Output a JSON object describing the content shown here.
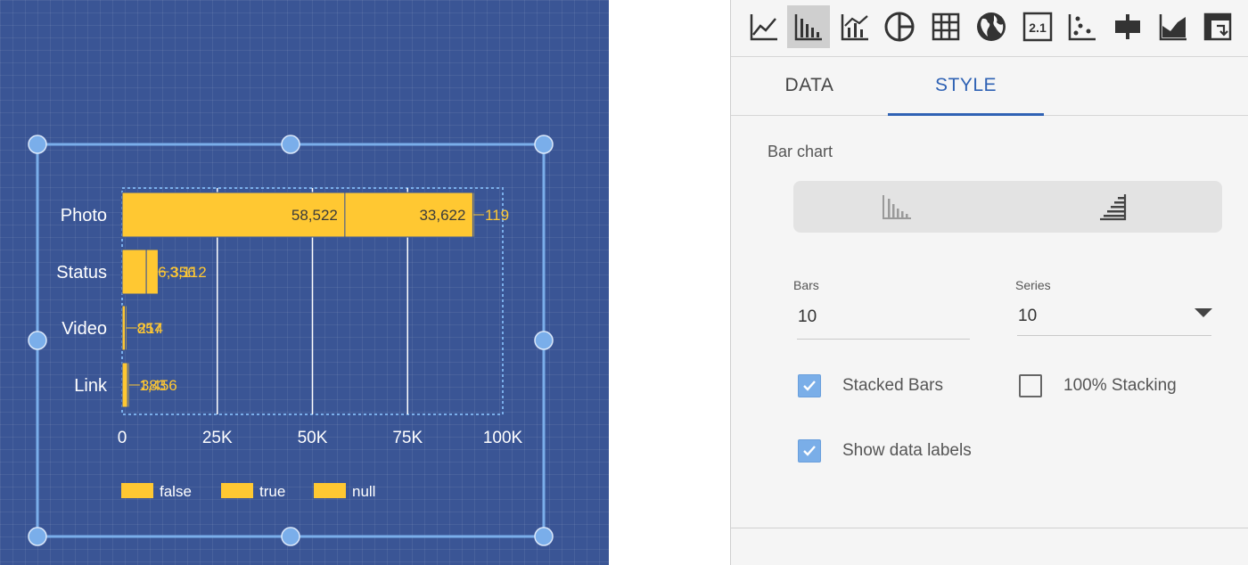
{
  "chart_data": {
    "type": "bar",
    "orientation": "horizontal",
    "stacked": true,
    "categories": [
      "Photo",
      "Status",
      "Video",
      "Link"
    ],
    "series": [
      {
        "name": "false",
        "values": [
          58522,
          6356,
          857,
          1456
        ]
      },
      {
        "name": "true",
        "values": [
          33622,
          3112,
          214,
          383
        ]
      },
      {
        "name": "null",
        "values": [
          119,
          0,
          0,
          0
        ]
      }
    ],
    "data_labels": [
      [
        "58,522",
        "33,622",
        "119"
      ],
      [
        "6,356",
        "3,112",
        ""
      ],
      [
        "857",
        "214",
        ""
      ],
      [
        "1,456",
        "383",
        ""
      ]
    ],
    "xticks": [
      "0",
      "25K",
      "50K",
      "75K",
      "100K"
    ],
    "xlim": [
      0,
      100000
    ],
    "grid": true,
    "legend_position": "bottom-left",
    "colors": {
      "bar": "#ffc832",
      "label_inside": "#3b3b3b",
      "label_outside": "#ffc832",
      "background": "#3a5595",
      "selection": "#7aaeea"
    }
  },
  "toolbar": {
    "icons": [
      "line-chart-icon",
      "bar-chart-icon",
      "combo-chart-icon",
      "pie-chart-icon",
      "table-icon",
      "geo-map-icon",
      "scorecard-icon",
      "scatter-chart-icon",
      "bullet-chart-icon",
      "area-chart-icon",
      "pivot-table-icon"
    ],
    "selected": "bar-chart-icon",
    "scorecard_glyph": "2.1"
  },
  "tabs": [
    {
      "label": "DATA",
      "active": false
    },
    {
      "label": "STYLE",
      "active": true
    }
  ],
  "style": {
    "section_title": "Bar chart",
    "orientation": "vertical",
    "bars_label": "Bars",
    "bars_value": "10",
    "series_label": "Series",
    "series_value": "10",
    "stacked_bars_label": "Stacked Bars",
    "stacked_bars_checked": true,
    "stacking_100_label": "100% Stacking",
    "stacking_100_checked": false,
    "show_data_labels_label": "Show data labels",
    "show_data_labels_checked": true
  }
}
